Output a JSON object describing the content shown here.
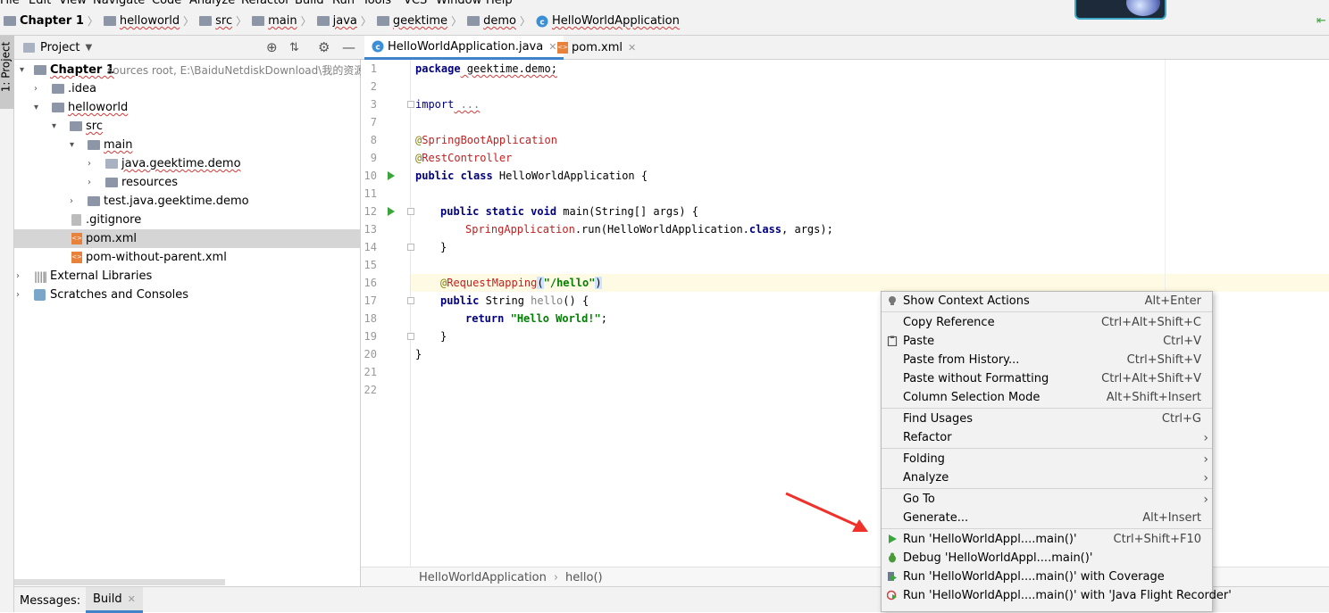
{
  "menubar": [
    "File",
    "Edit",
    "View",
    "Navigate",
    "Code",
    "Analyze",
    "Refactor",
    "Build",
    "Run",
    "Tools",
    "VCS",
    "Window",
    "Help"
  ],
  "breadcrumbs": [
    {
      "label": "Chapter 1",
      "icon": "folder-icon",
      "bold": true
    },
    {
      "label": "helloworld",
      "icon": "folder-icon"
    },
    {
      "label": "src",
      "icon": "folder-icon"
    },
    {
      "label": "main",
      "icon": "folder-icon"
    },
    {
      "label": "java",
      "icon": "folder-icon"
    },
    {
      "label": "geektime",
      "icon": "folder-icon"
    },
    {
      "label": "demo",
      "icon": "folder-icon"
    },
    {
      "label": "HelloWorldApplication",
      "icon": "class-icon"
    }
  ],
  "sidebar": {
    "project_tab": "1: Project"
  },
  "project_panel": {
    "title": "Project",
    "tree": [
      {
        "label": "Chapter 1",
        "suffix": "sources root,  E:\\BaiduNetdiskDownload\\我的资源",
        "bold": true
      },
      {
        "label": ".idea"
      },
      {
        "label": "helloworld"
      },
      {
        "label": "src"
      },
      {
        "label": "main"
      },
      {
        "label": "java.geektime.demo"
      },
      {
        "label": "resources"
      },
      {
        "label": "test.java.geektime.demo"
      },
      {
        "label": ".gitignore"
      },
      {
        "label": "pom.xml"
      },
      {
        "label": "pom-without-parent.xml"
      },
      {
        "label": "External Libraries"
      },
      {
        "label": "Scratches and Consoles"
      }
    ]
  },
  "tabs": [
    {
      "label": "HelloWorldApplication.java",
      "active": true
    },
    {
      "label": "pom.xml",
      "active": false
    }
  ],
  "editor": {
    "line_numbers": [
      "1",
      "2",
      "3",
      "7",
      "8",
      "9",
      "10",
      "11",
      "12",
      "13",
      "14",
      "15",
      "16",
      "17",
      "18",
      "19",
      "20",
      "21",
      "22"
    ],
    "code": {
      "l1_kw": "package",
      "l1_rest": " geektime.demo;",
      "l3_kw": "import",
      "l3_rest": " ...",
      "l8_at": "@",
      "l8_ann": "SpringBootApplication",
      "l9_at": "@",
      "l9_ann": "RestController",
      "l10_kw": "public class",
      "l10_rest": " HelloWorldApplication {",
      "l12_kw": "public static void",
      "l12_rest": " main(String[] args) {",
      "l13_cls": "SpringApplication",
      "l13_a": ".run(HelloWorldApplication.",
      "l13_kw": "class",
      "l13_b": ", args);",
      "l14": "}",
      "l16_at": "@",
      "l16_ann": "RequestMapping",
      "l16_p1": "(",
      "l16_str": "\"/hello\"",
      "l16_p2": ")",
      "l17_kw": "public",
      "l17_a": " String ",
      "l17_fn": "hello",
      "l17_b": "() {",
      "l18_kw": "return",
      "l18_sp": " ",
      "l18_str": "\"Hello World!\"",
      "l18_end": ";",
      "l19": "}",
      "l20": "}"
    }
  },
  "status_breadcrumb": {
    "class": "HelloWorldApplication",
    "method": "hello()"
  },
  "bottom_tabs": {
    "messages": "Messages:",
    "build": "Build"
  },
  "context_menu": [
    {
      "label": "Show Context Actions",
      "shortcut": "Alt+Enter",
      "icon": "bulb-icon"
    },
    {
      "label": "Copy Reference",
      "shortcut": "Ctrl+Alt+Shift+C"
    },
    {
      "label": "Paste",
      "shortcut": "Ctrl+V",
      "icon": "clipboard-icon"
    },
    {
      "label": "Paste from History...",
      "shortcut": "Ctrl+Shift+V"
    },
    {
      "label": "Paste without Formatting",
      "shortcut": "Ctrl+Alt+Shift+V"
    },
    {
      "label": "Column Selection Mode",
      "shortcut": "Alt+Shift+Insert"
    },
    {
      "label": "Find Usages",
      "shortcut": "Ctrl+G"
    },
    {
      "label": "Refactor",
      "shortcut": ""
    },
    {
      "label": "Folding",
      "shortcut": ""
    },
    {
      "label": "Analyze",
      "shortcut": ""
    },
    {
      "label": "Go To",
      "shortcut": ""
    },
    {
      "label": "Generate...",
      "shortcut": "Alt+Insert"
    },
    {
      "label": "Run 'HelloWorldAppl....main()'",
      "shortcut": "Ctrl+Shift+F10",
      "icon": "run-icon"
    },
    {
      "label": "Debug 'HelloWorldAppl....main()'",
      "shortcut": "",
      "icon": "debug-icon"
    },
    {
      "label": "Run 'HelloWorldAppl....main()' with Coverage",
      "shortcut": "",
      "icon": "coverage-icon"
    },
    {
      "label": "Run 'HelloWorldAppl....main()' with 'Java Flight Recorder'",
      "shortcut": "",
      "icon": "profiler-icon"
    }
  ]
}
